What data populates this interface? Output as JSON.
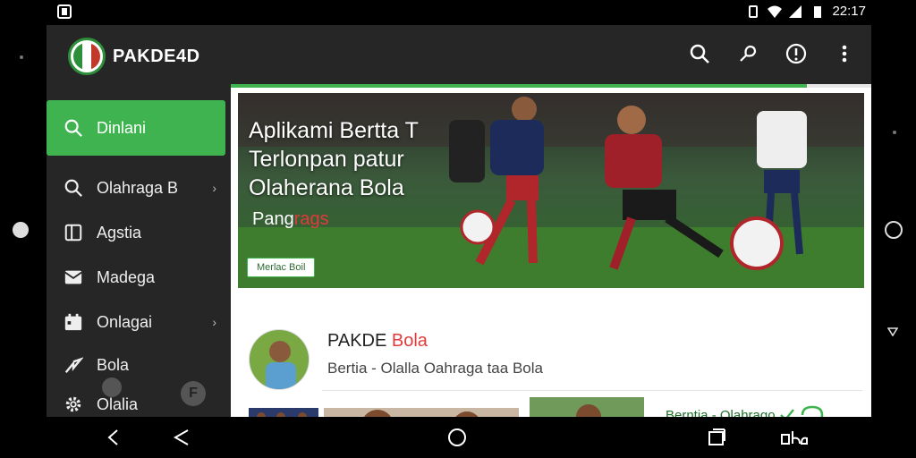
{
  "status": {
    "time": "22:17"
  },
  "app": {
    "title": "PAKDE4D"
  },
  "header": {
    "icons": [
      "search-icon",
      "mic-icon",
      "info-icon",
      "more-vert-icon"
    ]
  },
  "sidebar": {
    "items": [
      {
        "label": "Dinlani",
        "icon": "search-icon",
        "active": true
      },
      {
        "label": "Olahraga B",
        "icon": "search-icon",
        "chevron": true
      },
      {
        "label": "Agstia",
        "icon": "book-icon"
      },
      {
        "label": "Madega",
        "icon": "mail-icon"
      },
      {
        "label": "Onlagai",
        "icon": "calendar-icon",
        "chevron": true
      },
      {
        "label": "Bola",
        "icon": "arrow-icon"
      },
      {
        "label": "Olalia",
        "icon": "gear-icon"
      }
    ],
    "fab_b_label": "F"
  },
  "main": {
    "progress": 0.9,
    "hero": {
      "title_lines": [
        "Aplikami Bertta T",
        "Terlonpan patur",
        "Olaherana Bola"
      ],
      "subtitle_prefix": "Pang",
      "subtitle_red": "rags",
      "button_label": "Merlac Boil"
    },
    "card": {
      "title_prefix": "PAKDE",
      "title_red": "Bola",
      "subtitle": "Bertia - Olalla Oahraga taa Bola"
    },
    "news_link": "Berntia - Olahrago"
  },
  "colors": {
    "accent": "#3fb350",
    "header": "#262626",
    "red": "#e03b3b"
  }
}
